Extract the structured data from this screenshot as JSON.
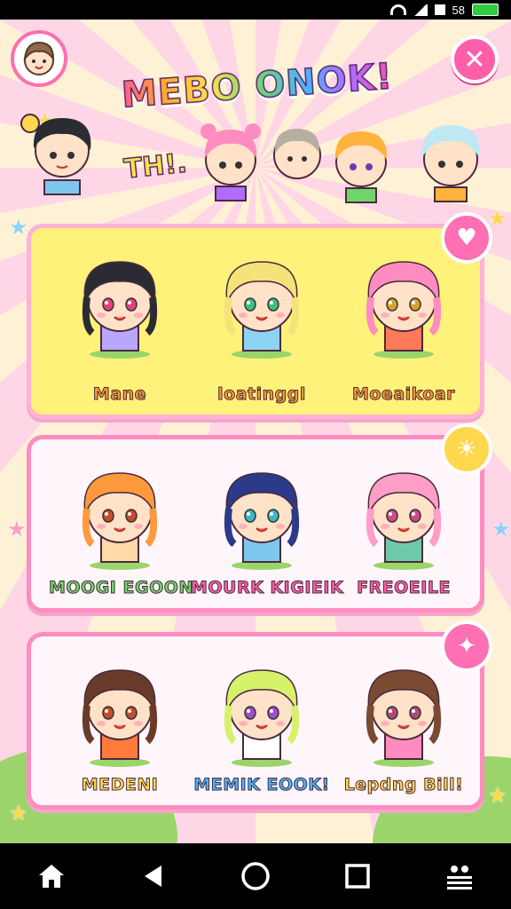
{
  "status_bar": {
    "battery_text": "58"
  },
  "header": {
    "title": "MEBO ONOK!",
    "subtitle": "TH!."
  },
  "cards": [
    {
      "style": "yellow",
      "badge_icon": "heart-icon",
      "characters": [
        {
          "name": "Mane",
          "hair": "#2b2b33",
          "outfit": "#b9a7ff",
          "eye": "#e0457a",
          "name_color": "#ff9a2b"
        },
        {
          "name": "loatinggl",
          "hair": "#f6e27a",
          "outfit": "#8fd3f4",
          "eye": "#3fbf7f",
          "name_color": "#ff9a2b"
        },
        {
          "name": "Moeaikoar",
          "hair": "#ff8cc0",
          "outfit": "#ff7a5a",
          "eye": "#d9a02b",
          "name_color": "#ff9a2b"
        }
      ]
    },
    {
      "style": "light",
      "badge_icon": "sun-icon",
      "characters": [
        {
          "name": "MOOGI EGOON",
          "hair": "#ff9a3c",
          "outfit": "#ffd9a8",
          "eye": "#c94a2a",
          "name_color": "#6fd66a"
        },
        {
          "name": "MOURK KIGIEIK",
          "hair": "#2c3a8a",
          "outfit": "#7ec8f0",
          "eye": "#3fb6c9",
          "name_color": "#ff5fa8"
        },
        {
          "name": "FREOEILE",
          "hair": "#ff9ec7",
          "outfit": "#6fc9a8",
          "eye": "#d04a8a",
          "name_color": "#ff5fa8"
        }
      ]
    },
    {
      "style": "light",
      "badge_icon": "wand-icon",
      "characters": [
        {
          "name": "MEDENI",
          "hair": "#6a3b2a",
          "outfit": "#ff7a3c",
          "eye": "#c94a2a",
          "name_color": "#ffd84d"
        },
        {
          "name": "MEMIK EOOK!",
          "hair": "#d6f26a",
          "outfit": "#ffffff",
          "eye": "#a04ad0",
          "name_color": "#48b6ff"
        },
        {
          "name": "Lepdng Bill!",
          "hair": "#7a4a32",
          "outfit": "#ff8cc0",
          "eye": "#b04a7a",
          "name_color": "#ffd84d"
        }
      ]
    }
  ],
  "nav": [
    "home-icon",
    "back-icon",
    "recent-home-circle-icon",
    "overview-square-icon",
    "menu-icon"
  ]
}
